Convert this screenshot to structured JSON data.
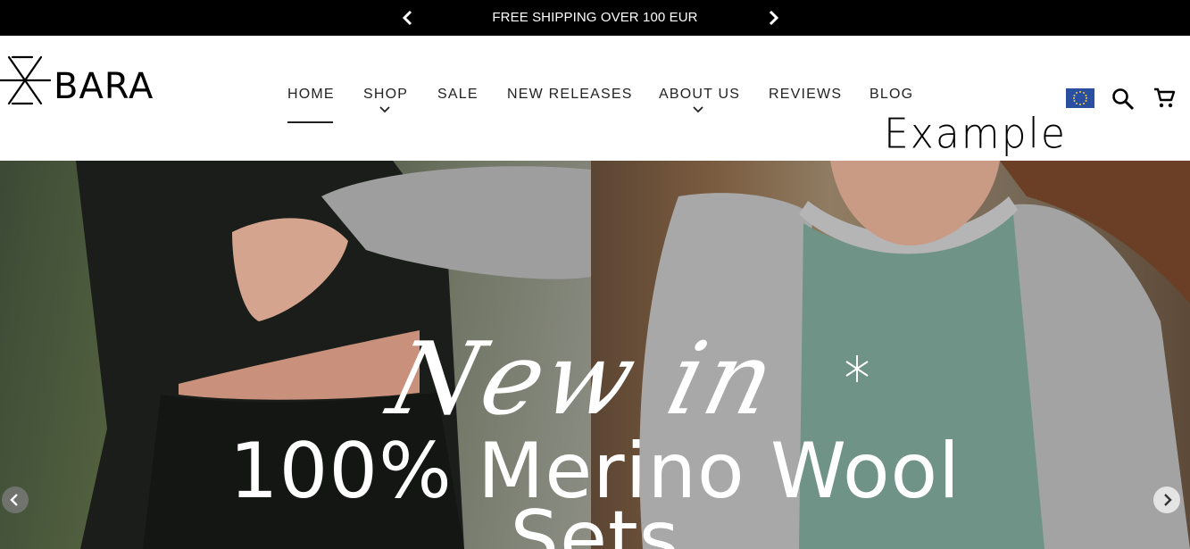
{
  "announcement": {
    "text": "FREE SHIPPING OVER 100 EUR",
    "prev_icon": "chevron-left-icon",
    "next_icon": "chevron-right-icon"
  },
  "brand": {
    "logo_text": "BARA"
  },
  "nav": {
    "items": [
      {
        "label": "HOME",
        "active": true
      },
      {
        "label": "SHOP",
        "has_dropdown": true
      },
      {
        "label": "SALE"
      },
      {
        "label": "NEW RELEASES"
      },
      {
        "label": "ABOUT US",
        "has_dropdown": true
      },
      {
        "label": "REVIEWS"
      },
      {
        "label": "BLOG"
      }
    ]
  },
  "annotation": {
    "handwritten_text": "Example"
  },
  "header_icons": {
    "region_icon": "eu-flag-icon",
    "search_icon": "search-icon",
    "cart_icon": "cart-icon"
  },
  "hero": {
    "script_text": "New in",
    "title_line1": "100% Merino Wool",
    "title_line2": "Sets",
    "prev_icon": "chevron-left-icon",
    "next_icon": "chevron-right-icon"
  },
  "colors": {
    "topbar_bg": "#000000",
    "header_bg": "#ffffff",
    "text": "#222222",
    "eu_flag_blue": "#2a4ea0",
    "eu_flag_stars": "#f4d03f"
  }
}
